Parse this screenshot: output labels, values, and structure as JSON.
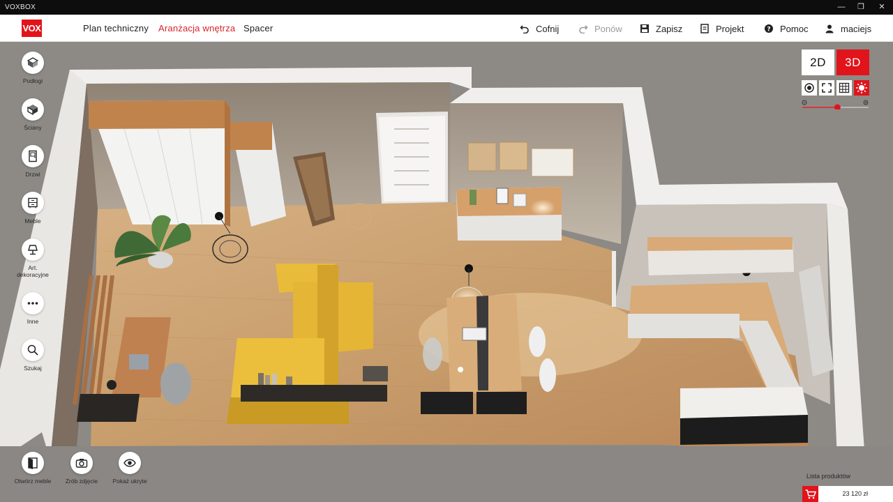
{
  "window": {
    "title": "VOXBOX",
    "controls": {
      "minimize": "—",
      "restore": "❐",
      "close": "✕"
    }
  },
  "header": {
    "logo": "VOX",
    "tabs": [
      {
        "label": "Plan techniczny",
        "active": false
      },
      {
        "label": "Aranżacja wnętrza",
        "active": true
      },
      {
        "label": "Spacer",
        "active": false
      }
    ],
    "tools": {
      "undo": "Cofnij",
      "redo": "Ponów",
      "save": "Zapisz",
      "project": "Projekt",
      "help": "Pomoc",
      "user": "maciejs"
    }
  },
  "sidebar": {
    "items": [
      {
        "label": "Podłogi",
        "icon": "floor-icon"
      },
      {
        "label": "Ściany",
        "icon": "walls-icon"
      },
      {
        "label": "Drzwi",
        "icon": "door-icon"
      },
      {
        "label": "Meble",
        "icon": "furniture-icon"
      },
      {
        "label": "Art.\ndekoracyjne",
        "label_line1": "Art.",
        "label_line2": "dekoracyjne",
        "icon": "lamp-icon"
      },
      {
        "label": "Inne",
        "icon": "more-icon"
      },
      {
        "label": "Szukaj",
        "icon": "search-icon"
      }
    ]
  },
  "bottom_tools": {
    "open_furniture": "Otwórz meble",
    "take_photo": "Zrób zdjęcie",
    "show_hidden": "Pokaż ukryte"
  },
  "view": {
    "mode_2d": "2D",
    "mode_3d": "3D",
    "active_mode": "3D",
    "zoom_fraction": 0.53
  },
  "cart": {
    "list_label": "Lista produktów",
    "total": "23 120 zł"
  },
  "colors": {
    "accent": "#e1141b",
    "floor": "#c9a172",
    "sofa": "#e5b737"
  }
}
